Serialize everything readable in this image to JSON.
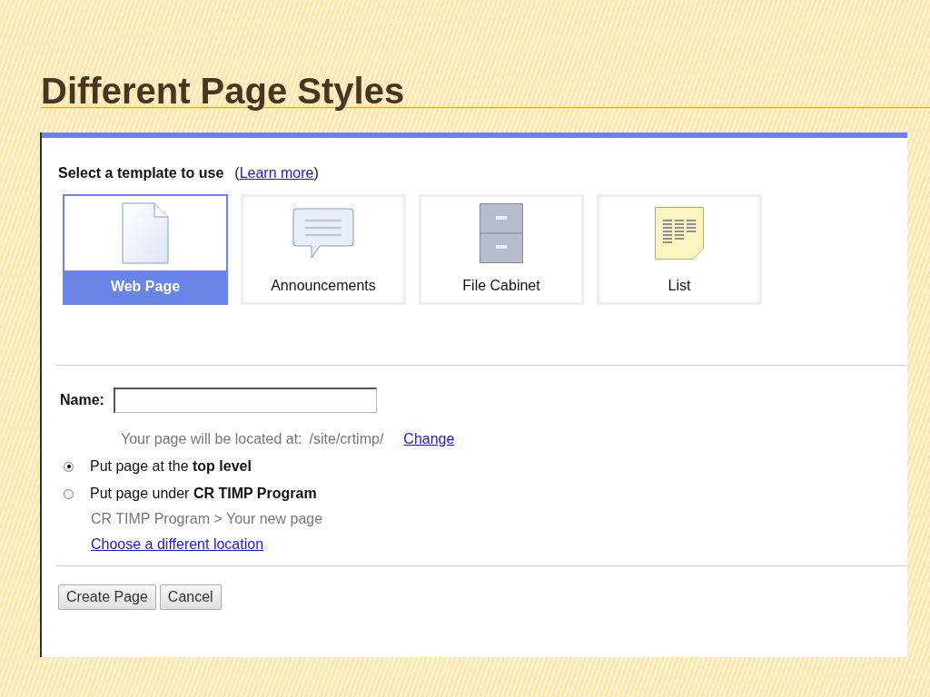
{
  "slide": {
    "title": "Different Page Styles"
  },
  "heading": [
    {
      "kind": "bold",
      "text": "Select a template to use"
    },
    {
      "kind": "text",
      "text": "("
    },
    {
      "kind": "link",
      "text": "Learn more"
    },
    {
      "kind": "text",
      "text": ")"
    }
  ],
  "templates": [
    {
      "kind": "page",
      "label": "Web Page",
      "selected": true
    },
    {
      "kind": "announcement",
      "label": "Announcements",
      "selected": false
    },
    {
      "kind": "cabinet",
      "label": "File Cabinet",
      "selected": false
    },
    {
      "kind": "list",
      "label": "List",
      "selected": false
    }
  ],
  "name": {
    "label": "Name:"
  },
  "location": {
    "text": "Your page will be located at:",
    "path": "/site/crtimp/",
    "link": "Change"
  },
  "placement": [
    {
      "text": "Put page at the **top level**",
      "selected": true
    },
    {
      "text": "Put page under **CR TIMP Program**",
      "selected": false
    }
  ],
  "breadcrumb": "CR TIMP Program > Your new page",
  "choose_link": "Choose a different location",
  "buttons": [
    "Create Page",
    "Cancel"
  ]
}
